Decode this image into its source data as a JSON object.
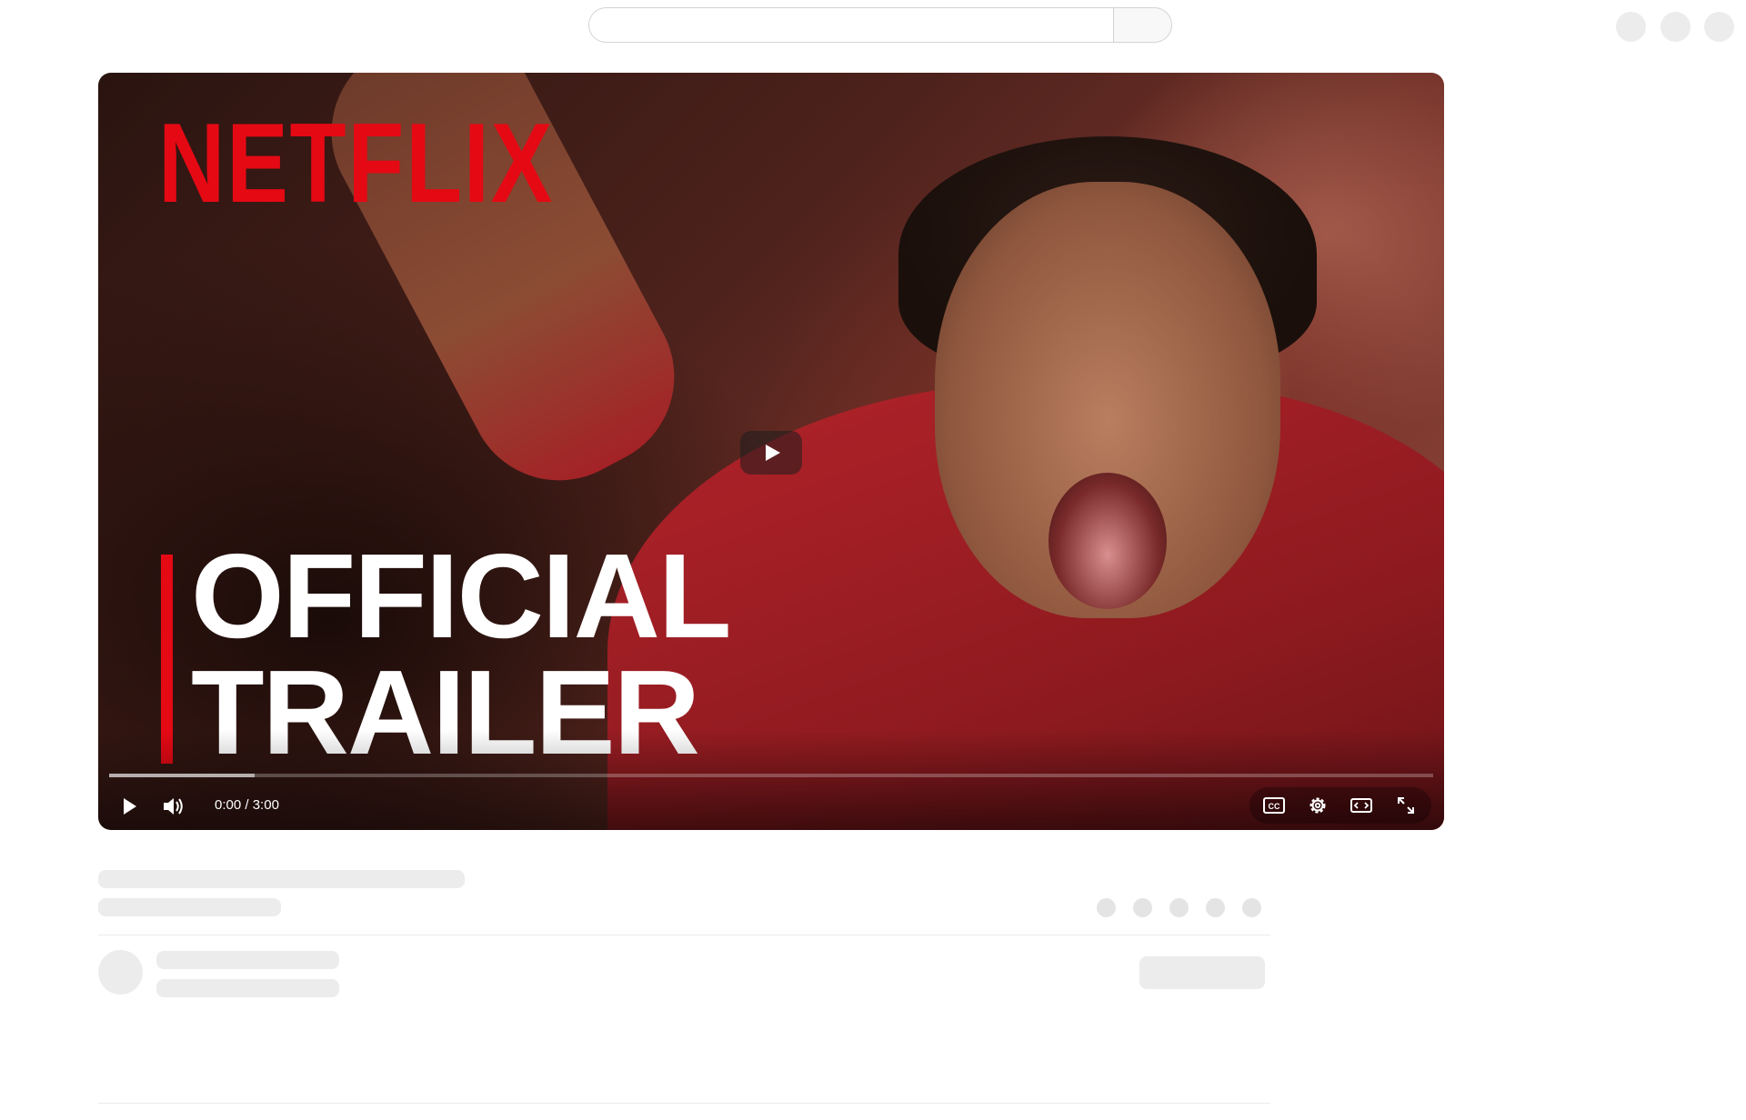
{
  "player": {
    "logo_text": "NETFLIX",
    "title_text": "OFFICIAL\nTRAILER",
    "time_current": "0:00",
    "time_separator": " / ",
    "time_total": "3:00",
    "buffered_fraction": 0.11,
    "played_fraction": 0.0,
    "controls": {
      "left": [
        "play-icon",
        "volume-icon"
      ],
      "right": [
        "closed-captions-icon",
        "settings-gear-icon",
        "theater-mode-icon",
        "fullscreen-icon"
      ]
    }
  },
  "colors": {
    "netflix_red": "#e50914",
    "skeleton": "#ececec"
  }
}
